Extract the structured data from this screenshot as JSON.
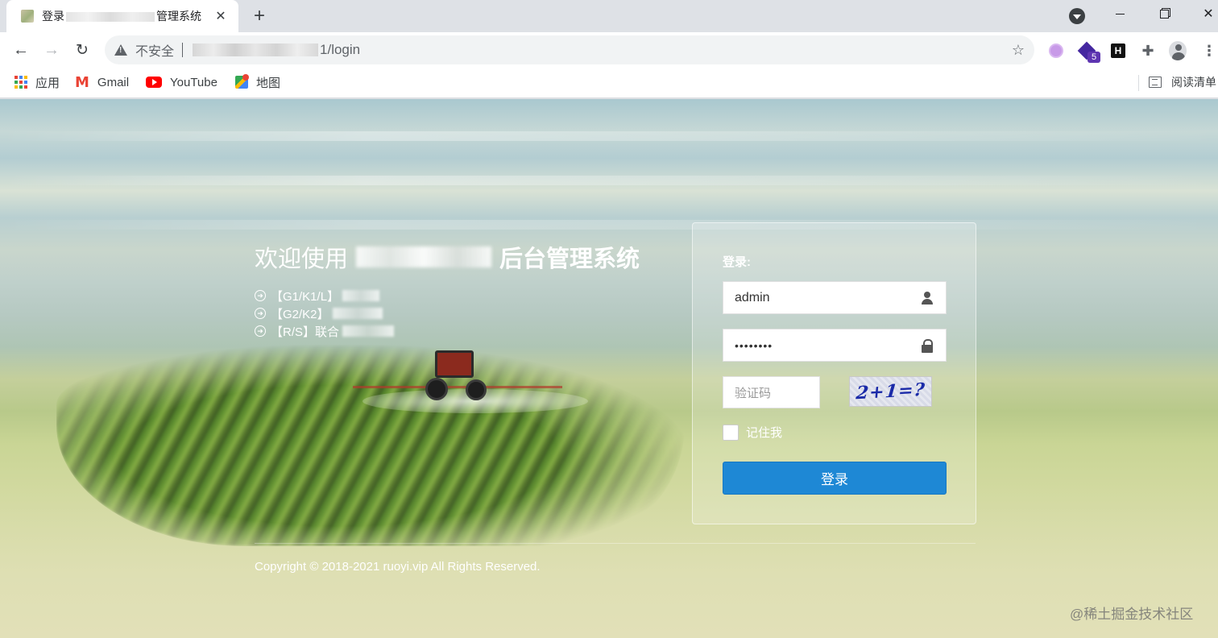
{
  "browser": {
    "tab": {
      "title_prefix": "登录",
      "title_suffix": "管理系统",
      "close_glyph": "✕"
    },
    "new_tab_glyph": "+",
    "window_controls": {
      "close_glyph": "✕"
    },
    "nav": {
      "back_glyph": "←",
      "forward_glyph": "→",
      "reload_glyph": "↻"
    },
    "omnibox": {
      "security_label": "不安全",
      "url_suffix": "1/login",
      "bookmark_star_glyph": "☆"
    },
    "extensions": {
      "badge_count": "5",
      "h_label": "H",
      "puzzle_glyph": "✚",
      "menu_glyph": "⋮"
    },
    "bookmarks": [
      {
        "label": "应用",
        "icon": "apps-grid-icon"
      },
      {
        "label": "Gmail",
        "icon": "gmail-icon"
      },
      {
        "label": "YouTube",
        "icon": "youtube-icon"
      },
      {
        "label": "地图",
        "icon": "maps-icon"
      }
    ],
    "reading_list_label": "阅读清单",
    "gmail_glyph": "M"
  },
  "page": {
    "welcome": {
      "prefix": "欢迎使用",
      "suffix": "后台管理系统"
    },
    "features": [
      {
        "label": "【G1/K1/L】"
      },
      {
        "label": "【G2/K2】"
      },
      {
        "label": "【R/S】联合"
      }
    ],
    "bullet_glyph": "➜",
    "login": {
      "heading": "登录:",
      "username_value": "admin",
      "password_value": "••••••••",
      "captcha_placeholder": "验证码",
      "captcha_text": "2+1=?",
      "remember_label": "记住我",
      "submit_label": "登录"
    },
    "copyright": "Copyright © 2018-2021 ruoyi.vip All Rights Reserved.",
    "watermark": "@稀土掘金技术社区"
  },
  "colors": {
    "primary_button": "#1e88d5",
    "tabstrip": "#dee1e6",
    "youtube_red": "#ff0000",
    "gmail_red": "#ea4335"
  }
}
